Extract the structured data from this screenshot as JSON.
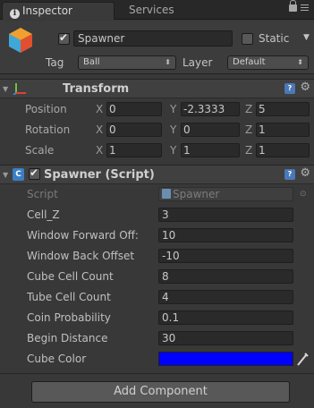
{
  "tabs": {
    "inspector": "Inspector",
    "services": "Services"
  },
  "gameobject": {
    "active": true,
    "name": "Spawner",
    "static_label": "Static",
    "tag_label": "Tag",
    "tag_value": "Ball",
    "layer_label": "Layer",
    "layer_value": "Default"
  },
  "transform": {
    "title": "Transform",
    "rows": [
      {
        "label": "Position",
        "x": "0",
        "y": "-2.3333",
        "z": "5"
      },
      {
        "label": "Rotation",
        "x": "0",
        "y": "0",
        "z": "1"
      },
      {
        "label": "Scale",
        "x": "1",
        "y": "1",
        "z": "1"
      }
    ],
    "axis_x": "X",
    "axis_y": "Y",
    "axis_z": "Z"
  },
  "script_component": {
    "title": "Spawner (Script)",
    "enabled": true,
    "script_label": "Script",
    "script_value": "Spawner",
    "fields": [
      {
        "label": "Cell_Z",
        "value": "3"
      },
      {
        "label": "Window Forward Off:",
        "value": "10"
      },
      {
        "label": "Window Back Offset",
        "value": "-10"
      },
      {
        "label": "Cube Cell Count",
        "value": "8"
      },
      {
        "label": "Tube Cell Count",
        "value": "4"
      },
      {
        "label": "Coin Probability",
        "value": "0.1"
      },
      {
        "label": "Begin Distance",
        "value": "30"
      }
    ],
    "color_label": "Cube Color",
    "color_value": "#0000ff"
  },
  "add_component": "Add Component",
  "icons": {
    "info": "info-icon",
    "lock": "lock-icon",
    "menu": "menu-icon",
    "help": "help-icon",
    "gear": "gear-icon",
    "script": "script-icon",
    "picker": "eyedropper-icon"
  }
}
